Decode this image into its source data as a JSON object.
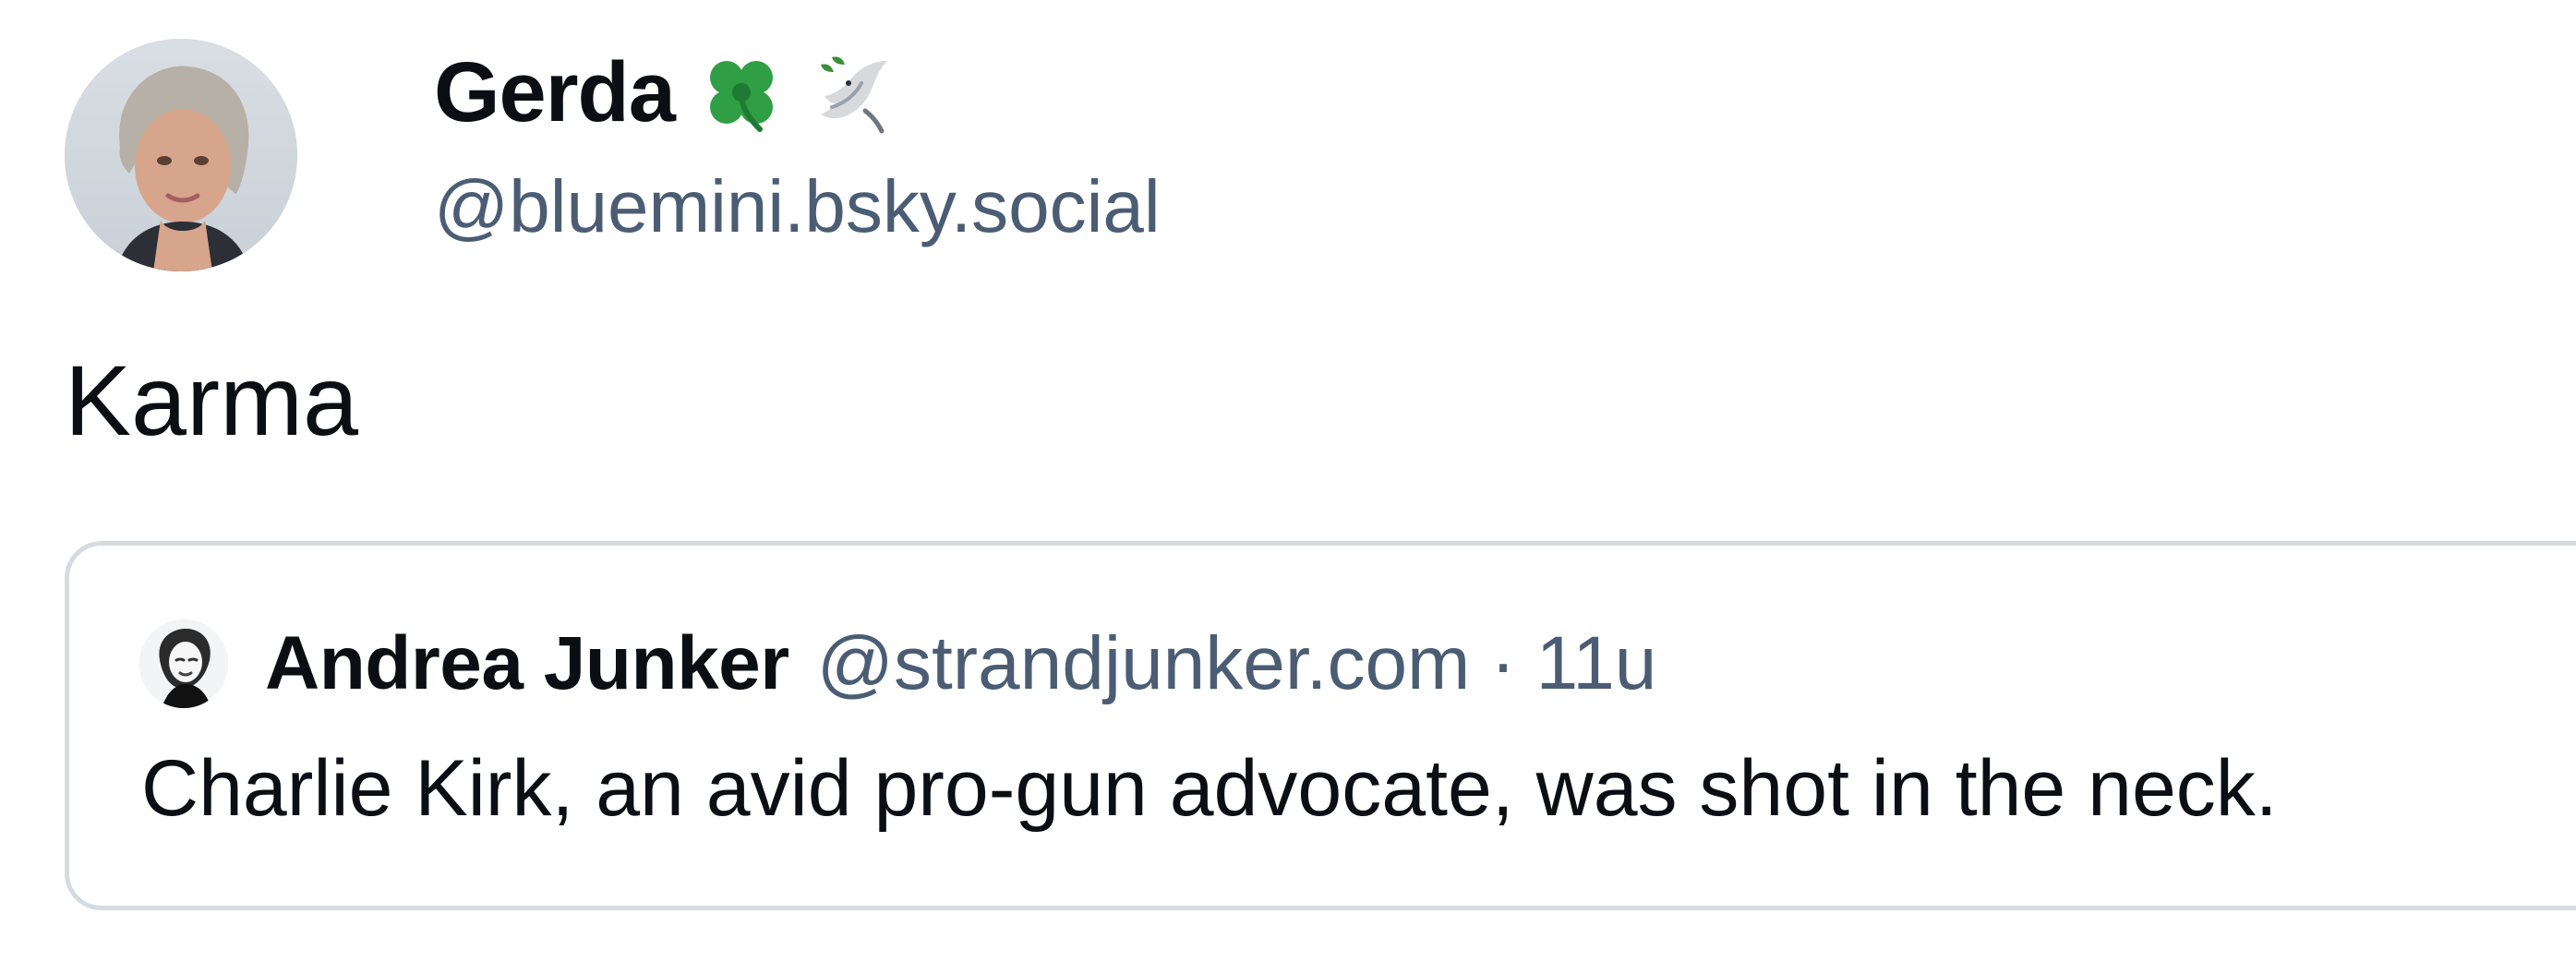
{
  "post": {
    "author": {
      "display_name": "Gerda",
      "handle": "@bluemini.bsky.social",
      "emoji": [
        "four-leaf-clover-icon",
        "dove-icon"
      ]
    },
    "text": "Karma"
  },
  "quote": {
    "author": {
      "display_name": "Andrea Junker",
      "handle": "@strandjunker.com"
    },
    "separator": "·",
    "time": "11u",
    "text": "Charlie Kirk, an avid pro-gun advocate, was shot in the neck."
  },
  "colors": {
    "text": "#0b0f14",
    "muted": "#4b5d74",
    "border": "#d6dbe1",
    "clover": "#2f9e44"
  }
}
